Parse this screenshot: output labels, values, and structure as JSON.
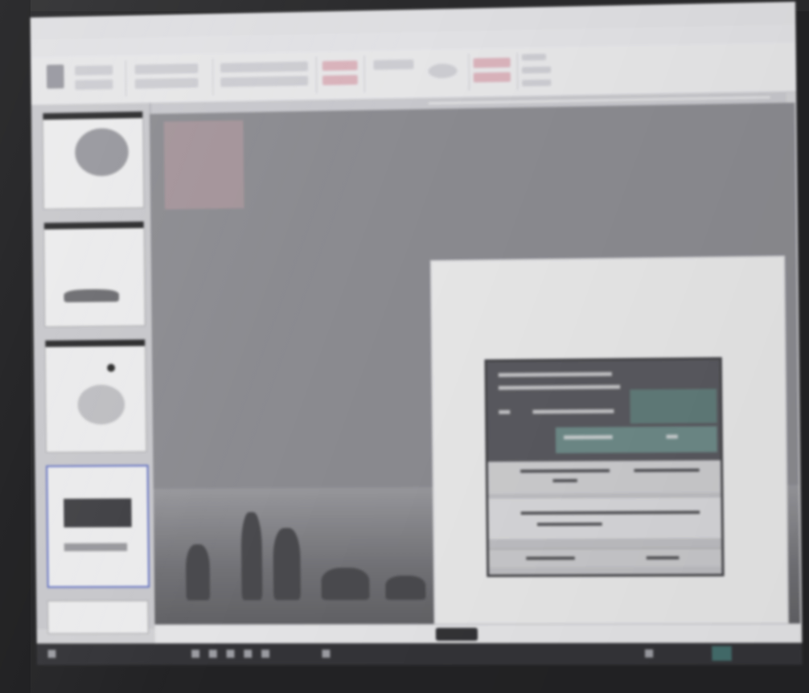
{
  "app": {
    "window_title": "",
    "ribbon_tabs": [
      "",
      "",
      "",
      "",
      "",
      "",
      "",
      ""
    ]
  },
  "slide": {
    "title": ""
  },
  "status": {
    "zoom": ""
  },
  "icons": {
    "taskbar": [
      "start-icon",
      "app-icon",
      "app-icon",
      "app-icon",
      "app-icon",
      "app-icon",
      "app-icon"
    ],
    "view_buttons": [
      "normal-view-icon",
      "sorter-view-icon",
      "reading-view-icon",
      "slideshow-icon"
    ]
  },
  "colors": {
    "accent_teal": "#5d7a78",
    "selection": "#5a6cc7"
  }
}
